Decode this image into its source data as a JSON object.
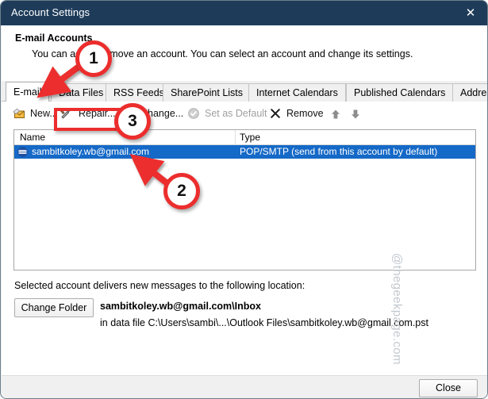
{
  "window": {
    "title": "Account Settings",
    "close_icon": "close-icon"
  },
  "header": {
    "title": "E-mail Accounts",
    "subtitle": "You can add or remove an account. You can select an account and change its settings."
  },
  "tabs": [
    {
      "label": "E-mail",
      "active": true
    },
    {
      "label": "Data Files",
      "active": false
    },
    {
      "label": "RSS Feeds",
      "active": false
    },
    {
      "label": "SharePoint Lists",
      "active": false
    },
    {
      "label": "Internet Calendars",
      "active": false
    },
    {
      "label": "Published Calendars",
      "active": false
    },
    {
      "label": "Address Books",
      "active": false
    }
  ],
  "toolbar": {
    "new_label": "New...",
    "repair_label": "Repair...",
    "change_label": "Change...",
    "set_default_label": "Set as Default",
    "remove_label": "Remove",
    "move_up_label": "Move Up",
    "move_down_label": "Move Down"
  },
  "list": {
    "columns": [
      "Name",
      "Type"
    ],
    "rows": [
      {
        "name": "sambitkoley.wb@gmail.com",
        "type": "POP/SMTP (send from this account by default)",
        "selected": true
      }
    ]
  },
  "delivery": {
    "label": "Selected account delivers new messages to the following location:",
    "change_folder_label": "Change Folder",
    "path": "sambitkoley.wb@gmail.com\\Inbox",
    "data_file": "in data file C:\\Users\\sambi\\...\\Outlook Files\\sambitkoley.wb@gmail.com.pst"
  },
  "footer": {
    "close_label": "Close"
  },
  "watermark": {
    "text": "@thegeekpage.com"
  },
  "annotations": {
    "step1": "1",
    "step2": "2",
    "step3": "3"
  },
  "colors": {
    "titlebar": "#1e3c5a",
    "selection": "#1569c7",
    "annotation_red": "#ec2d2d",
    "disabled_text": "#a0a0a0"
  }
}
